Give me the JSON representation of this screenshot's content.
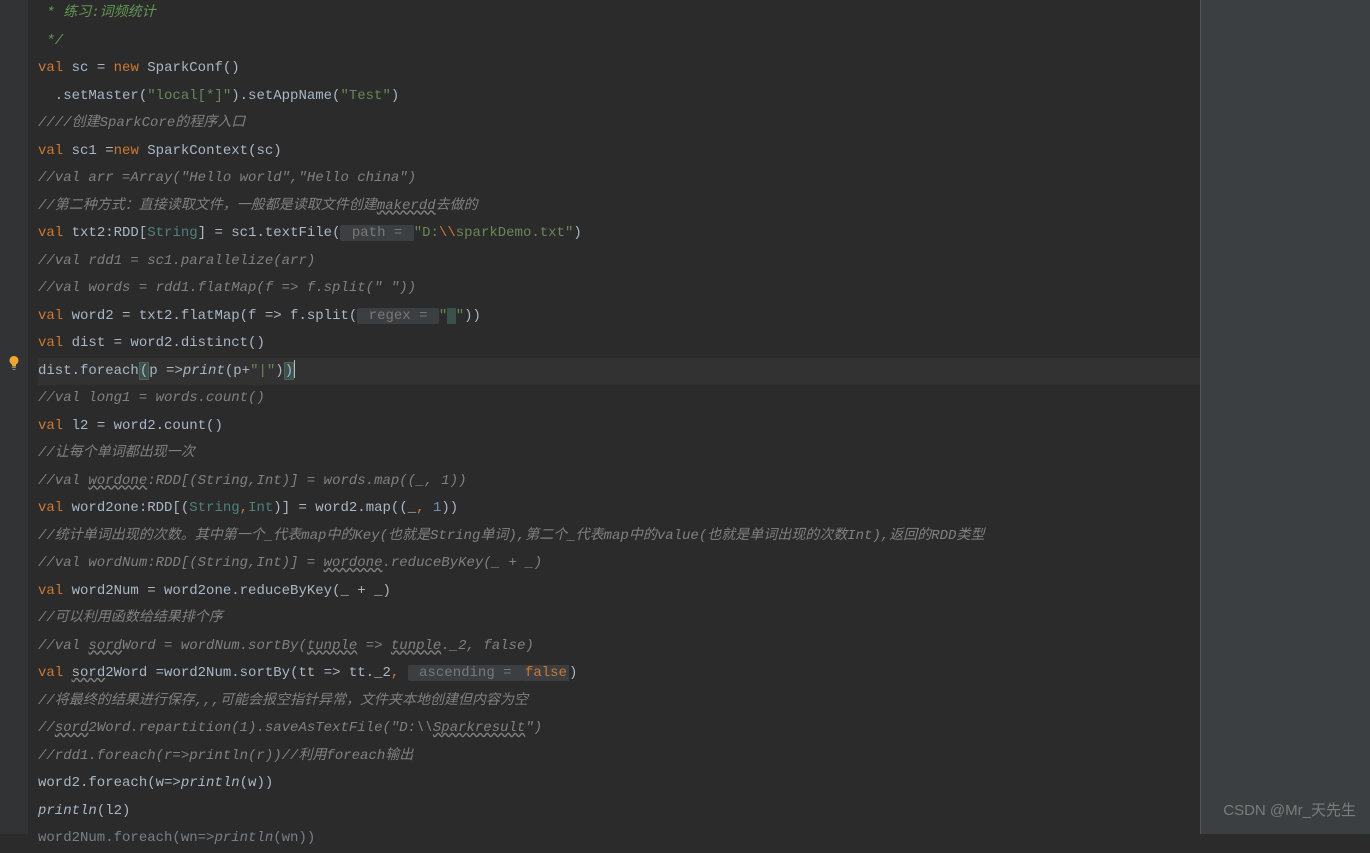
{
  "lines": {
    "l0": " * 练习:词频统计",
    "l1": " */",
    "l2_val": "val",
    "l2_sc": " sc = ",
    "l2_new": "new",
    "l2_rest": " SparkConf()",
    "l3_a": "  .setMaster(",
    "l3_s1": "\"local[*]\"",
    "l3_b": ").setAppName(",
    "l3_s2": "\"Test\"",
    "l3_c": ")",
    "l4": "////创建SparkCore的程序入口",
    "l5_val": "val",
    "l5_mid": " sc1 =",
    "l5_new": "new",
    "l5_rest": " SparkContext(sc)",
    "l6": "//val arr =Array(\"Hello world\",\"Hello china\")",
    "l7_a": "//第二种方式：直接读取文件，一般都是读取文件创建",
    "l7_wavy": "makerdd",
    "l7_b": "去做的",
    "l8_val": "val",
    "l8_a": " txt2:RDD[",
    "l8_type": "String",
    "l8_b": "] = sc1.textFile(",
    "l8_hint": " path = ",
    "l8_s1": "\"D:",
    "l8_esc": "\\\\",
    "l8_s2": "sparkDemo.txt\"",
    "l8_c": ")",
    "l9": "//val rdd1 = sc1.parallelize(arr)",
    "l10": "//val words = rdd1.flatMap(f => f.split(\" \"))",
    "l11_val": "val",
    "l11_a": " word2 = txt2.flatMap(f => f.split(",
    "l11_hint": " regex = ",
    "l11_s1": "\"",
    "l11_space": " ",
    "l11_s2": "\"",
    "l11_b": "))",
    "l12_val": "val",
    "l12_rest": " dist = word2.distinct()",
    "l13_a": "dist.foreach",
    "l13_p1": "(",
    "l13_b": "p =>",
    "l13_print": "print",
    "l13_c": "(p+",
    "l13_s": "\"|\"",
    "l13_d": ")",
    "l13_p2": ")",
    "l14": "//val long1 = words.count()",
    "l15_val": "val",
    "l15_rest": " l2 = word2.count()",
    "l16": "//让每个单词都出现一次",
    "l17_a": "//val ",
    "l17_wavy": "wordone",
    "l17_b": ":RDD[(String,Int)] = words.map((_, 1))",
    "l18_val": "val",
    "l18_a": " word2one:RDD[(",
    "l18_t1": "String",
    "l18_comma": ",",
    "l18_t2": "Int",
    "l18_b": ")] = word2.map((_",
    "l18_comma2": ", ",
    "l18_num": "1",
    "l18_c": "))",
    "l19": "//统计单词出现的次数。其中第一个_代表map中的Key(也就是String单词),第二个_代表map中的value(也就是单词出现的次数Int),返回的RDD类型",
    "l20_a": "//val wordNum:RDD[(String,Int)] = ",
    "l20_wavy": "wordone",
    "l20_b": ".reduceByKey(_ + _)",
    "l21_val": "val",
    "l21_rest": " word2Num = word2one.reduceByKey(_ + _)",
    "l22": "//可以利用函数给结果排个序",
    "l23_a": "//val ",
    "l23_w1": "sord",
    "l23_b": "Word = wordNum.sortBy(",
    "l23_w2": "tunple",
    "l23_c": " => ",
    "l23_w3": "tunple",
    "l23_d": "._2, false)",
    "l24_val": "val",
    "l24_a": " ",
    "l24_wavy": "sord",
    "l24_b": "2Word =word2Num.sortBy(tt => tt._2",
    "l24_comma": ", ",
    "l24_hint": " ascending = ",
    "l24_false": "false",
    "l24_c": ")",
    "l25": "//将最终的结果进行保存,,,可能会报空指针异常，文件夹本地创建但内容为空",
    "l26_a": "//",
    "l26_w": "sord",
    "l26_b": "2Word.repartition(1).saveAsTextFile(\"D:\\\\",
    "l26_w2": "Sparkresult",
    "l26_c": "\")",
    "l27": "//rdd1.foreach(r=>println(r))//利用foreach输出",
    "l28_a": "word2.foreach(w=>",
    "l28_print": "println",
    "l28_b": "(w))",
    "l29_print": "println",
    "l29_rest": "(l2)",
    "l30_a": "word2Num.foreach(wn=>",
    "l30_print": "println",
    "l30_b": "(wn))"
  },
  "watermark": "CSDN @Mr_天先生"
}
